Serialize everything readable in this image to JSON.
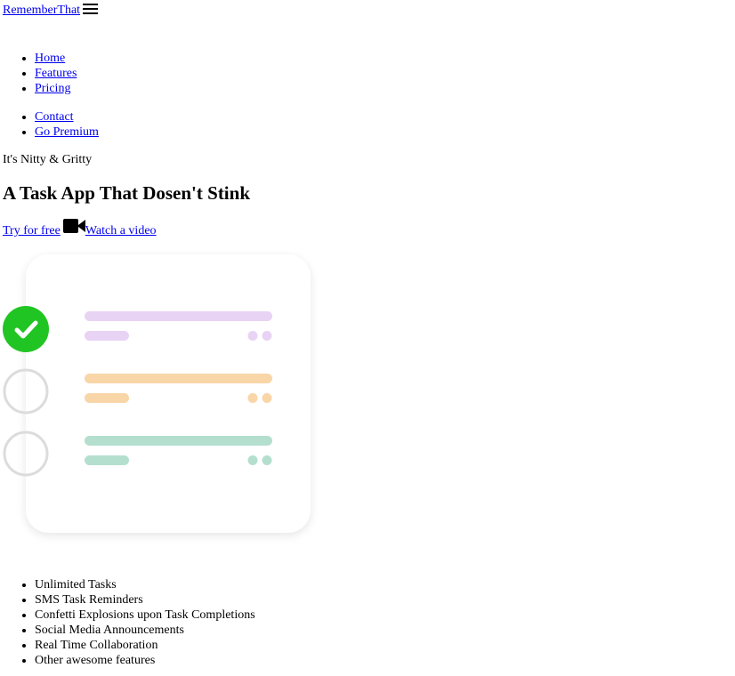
{
  "brand": {
    "name": "RememberThat",
    "menu_icon": "hamburger-menu-icon"
  },
  "nav": {
    "main": [
      {
        "label": "Home"
      },
      {
        "label": "Features"
      },
      {
        "label": "Pricing"
      }
    ],
    "secondary": [
      {
        "label": "Contact"
      },
      {
        "label": "Go Premium"
      }
    ]
  },
  "hero": {
    "tagline": "It's Nitty & Gritty",
    "headline": "A Task App That Dosen't Stink",
    "primary_cta": "Try for free",
    "video_icon": "video-camera-icon",
    "secondary_cta": "Watch a video"
  },
  "illustration": {
    "icon": "task-list-illustration",
    "tasks": [
      {
        "status": "completed",
        "color": "#e8d3f5"
      },
      {
        "status": "incomplete",
        "color": "#f9d6a8"
      },
      {
        "status": "incomplete",
        "color": "#b4dfce"
      }
    ],
    "check_color": "#21c523",
    "circle_color": "#dcdcdc"
  },
  "features": [
    {
      "label": "Unlimited Tasks"
    },
    {
      "label": "SMS Task Reminders"
    },
    {
      "label": "Confetti Explosions upon Task Completions"
    },
    {
      "label": "Social Media Announcements"
    },
    {
      "label": "Real Time Collaboration"
    },
    {
      "label": "Other awesome features"
    }
  ]
}
